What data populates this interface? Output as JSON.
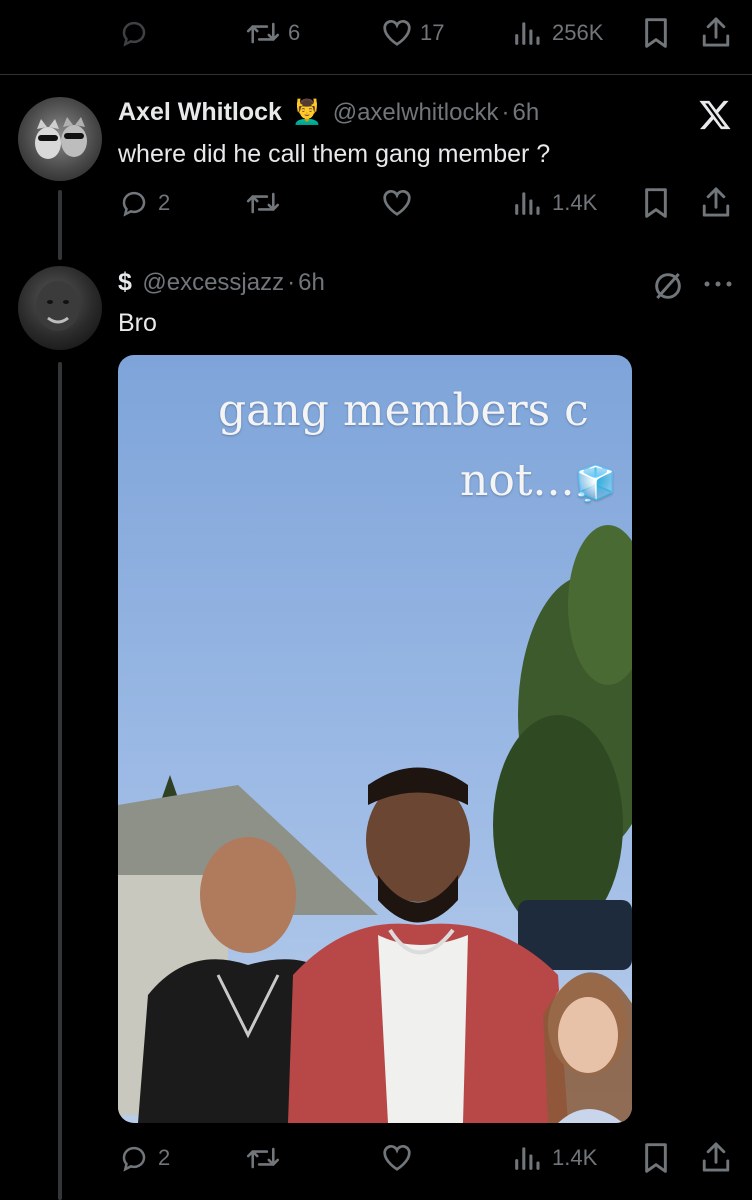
{
  "top_actions": {
    "replies": "",
    "reposts": "6",
    "likes": "17",
    "views": "256K"
  },
  "tweet1": {
    "name": "Axel Whitlock",
    "emoji": "💆‍♂️",
    "handle": "@axelwhitlockk",
    "sep": "·",
    "time": "6h",
    "text": "where did he call them gang member ?",
    "actions": {
      "replies": "2",
      "reposts": "",
      "likes": "",
      "views": "1.4K"
    }
  },
  "tweet2": {
    "name": "$",
    "handle": "@excessjazz",
    "sep": "·",
    "time": "6h",
    "text": "Bro",
    "media": {
      "caption_line1": "gang members c",
      "caption_line2": "not...",
      "caption_emoji": "🧊"
    },
    "actions": {
      "replies": "2",
      "reposts": "",
      "likes": "",
      "views": "1.4K"
    }
  },
  "colors": {
    "background": "#000000",
    "text_primary": "#e7e9ea",
    "text_secondary": "#71767b",
    "divider": "#2f3336",
    "sky": "#8fb2e0"
  },
  "icons": [
    "reply-icon",
    "repost-icon",
    "like-icon",
    "views-icon",
    "bookmark-icon",
    "share-icon",
    "x-logo-icon",
    "circle-slash-icon",
    "more-icon"
  ]
}
